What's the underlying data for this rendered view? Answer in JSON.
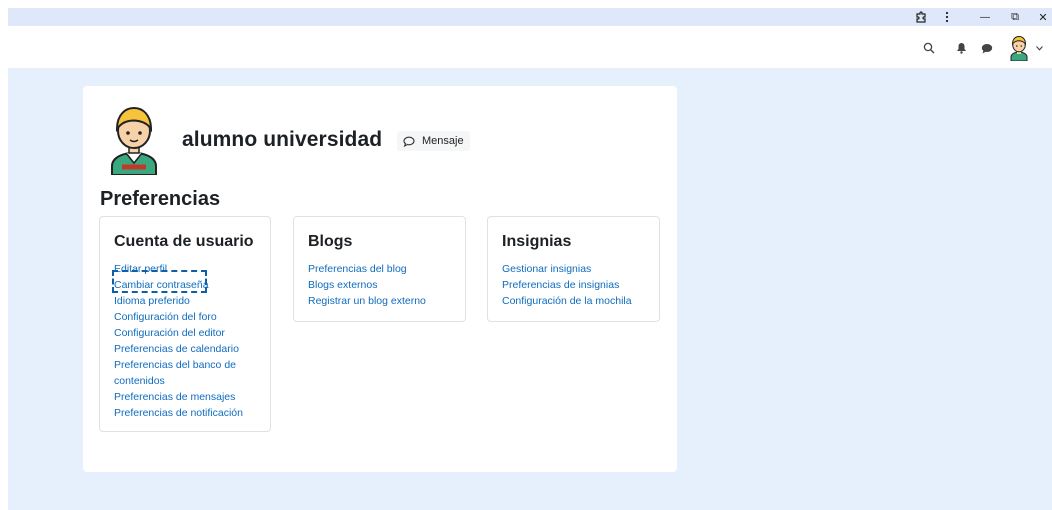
{
  "window": {
    "puzzle_icon": "puzzle-icon",
    "menu_icon": "kebab-menu-icon",
    "minimize_label": "—",
    "restore_label": "⧉",
    "close_label": "✕"
  },
  "topnav": {
    "icons": [
      "search-icon",
      "bell-icon",
      "chat-bubble-icon",
      "avatar",
      "chevron-down-icon"
    ]
  },
  "profile": {
    "name": "alumno universidad",
    "message_button": "Mensaje"
  },
  "preferences": {
    "title": "Preferencias",
    "sections": [
      {
        "title": "Cuenta de usuario",
        "links": [
          "Editar perfil",
          "Cambiar contraseña",
          "Idioma preferido",
          "Configuración del foro",
          "Configuración del editor",
          "Preferencias de calendario",
          "Preferencias del banco de",
          "contenidos",
          "Preferencias de mensajes",
          "Preferencias de notificación"
        ]
      },
      {
        "title": "Blogs",
        "links": [
          "Preferencias del blog",
          "Blogs externos",
          "Registrar un blog externo"
        ]
      },
      {
        "title": "Insignias",
        "links": [
          "Gestionar insignias",
          "Preferencias de insignias",
          "Configuración de la mochila"
        ]
      }
    ]
  },
  "colors": {
    "link": "#0f6cbf",
    "page_bg": "#e6effc",
    "titlebar_bg": "#dfe8fb",
    "focus": "#0f5fa8"
  }
}
